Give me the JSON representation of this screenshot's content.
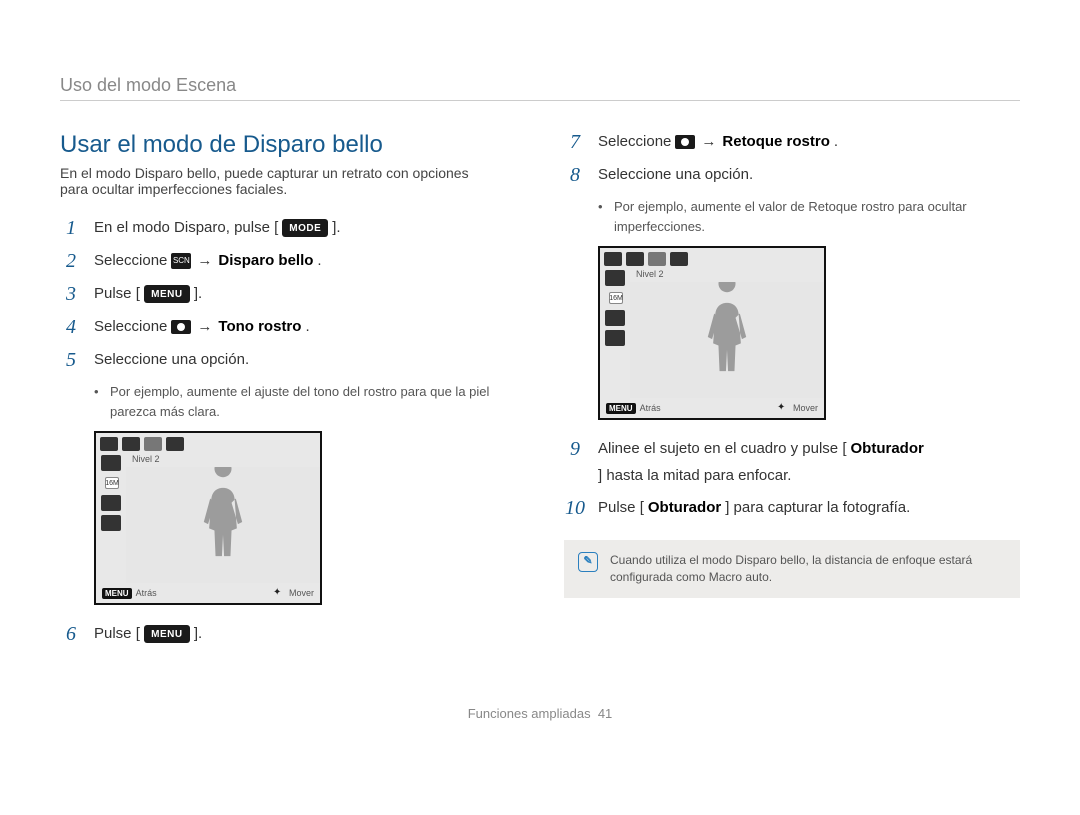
{
  "header": {
    "breadcrumb": "Uso del modo Escena"
  },
  "title": "Usar el modo de Disparo bello",
  "intro": "En el modo Disparo bello, puede capturar un retrato con opciones para ocultar imperfecciones faciales.",
  "labels": {
    "mode_button": "MODE",
    "menu_button": "MENU",
    "scn_icon": "SCN",
    "arrow": "→",
    "nivel_badge": "16M"
  },
  "steps_left": [
    {
      "n": "1",
      "pre": "En el modo Disparo, pulse [",
      "has_btn": "MODE",
      "post": "]."
    },
    {
      "n": "2",
      "pre": "Seleccione ",
      "has_icon": "scn",
      "arrow": true,
      "bold": "Disparo bello",
      "post": "."
    },
    {
      "n": "3",
      "pre": "Pulse [",
      "has_btn": "MENU",
      "post": "]."
    },
    {
      "n": "4",
      "pre": "Seleccione ",
      "has_icon": "camera",
      "arrow": true,
      "bold": "Tono rostro",
      "post": "."
    },
    {
      "n": "5",
      "pre": "Seleccione una opción."
    }
  ],
  "bullets_left": [
    "Por ejemplo, aumente el ajuste del tono del rostro para que la piel parezca más clara."
  ],
  "steps_left_after": [
    {
      "n": "6",
      "pre": "Pulse [",
      "has_btn": "MENU",
      "post": "]."
    }
  ],
  "steps_right": [
    {
      "n": "7",
      "pre": "Seleccione ",
      "has_icon": "camera",
      "arrow": true,
      "bold": "Retoque rostro",
      "post": "."
    },
    {
      "n": "8",
      "pre": "Seleccione una opción."
    }
  ],
  "bullets_right": [
    "Por ejemplo, aumente el valor de Retoque rostro para ocultar imperfecciones."
  ],
  "steps_right_after": [
    {
      "n": "9",
      "pre": "Alinee el sujeto en el cuadro y pulse [",
      "bold": "Obturador",
      "post": "] hasta la mitad para enfocar."
    },
    {
      "n": "10",
      "pre": "Pulse [",
      "bold": "Obturador",
      "post": "] para capturar la fotografía."
    }
  ],
  "device": {
    "level": "Nivel 2",
    "back": "Atrás",
    "move": "Mover",
    "menu": "MENU"
  },
  "info": "Cuando utiliza el modo Disparo bello, la distancia de enfoque estará configurada como Macro auto.",
  "footer": {
    "label": "Funciones ampliadas",
    "page": "41"
  }
}
